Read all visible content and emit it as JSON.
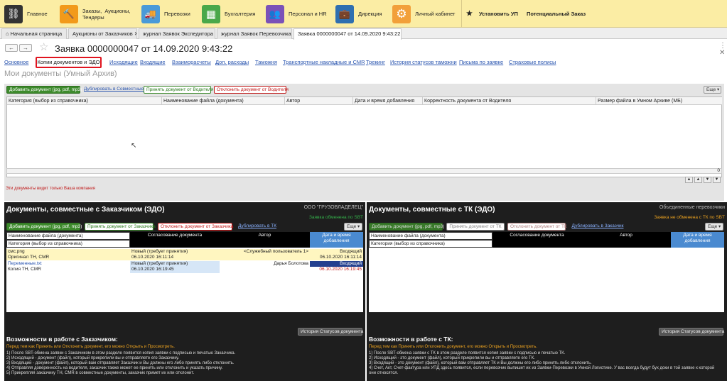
{
  "top_sections": [
    {
      "label": "Главное",
      "color": "#333333",
      "glyph": "⛓"
    },
    {
      "label": "Заказы,  Аукционы,\nТендеры",
      "color": "#f29a1a",
      "glyph": "🔨"
    },
    {
      "label": "Перевозки",
      "color": "#4a9ad8",
      "glyph": "🚚"
    },
    {
      "label": "Бухгалтерия",
      "color": "#4aa84a",
      "glyph": "▦"
    },
    {
      "label": "Персонал и HR",
      "color": "#7a52b8",
      "glyph": "👥"
    },
    {
      "label": "Дирекция",
      "color": "#2f6fb0",
      "glyph": "💼"
    },
    {
      "label": "Личный кабинет",
      "color": "#f2a03a",
      "glyph": "⚙"
    }
  ],
  "top_right": {
    "star": "★",
    "install": "Установить УП",
    "potential": "Потенциальный Заказ"
  },
  "tabs": [
    {
      "label": "⌂  Начальная страница"
    },
    {
      "label": "Аукционы от Заказчиков  ✕"
    },
    {
      "label": "журнал Заявок Экспедитора  ✕"
    },
    {
      "label": "журнал Заявок Перевозчика  ✕"
    },
    {
      "label": "Заявка 0000000047 от 14.09.2020 9:43:22  ✕"
    }
  ],
  "doc": {
    "title": "Заявка 0000000047 от 14.09.2020 9:43:22",
    "back": "←",
    "fwd": "→",
    "star": "☆",
    "win_ctrl": "⋮  ✕"
  },
  "links": [
    "Основное",
    "Копии документов и ЭДО",
    "Исходящие",
    "Входящие",
    "Взаиморасчеты",
    "Доп. расходы",
    "Таможня",
    "Транспортные накладные и CMR",
    "Трекинг",
    "История статусов таможни",
    "Письма по заявке",
    "Страховые полисы"
  ],
  "subtitle": "Мои документы (Умный Архив)",
  "archive": {
    "add_btn": "Добавить документ (jpg, pdf, mp3)",
    "dup_btn": "Дублировать в Совместные",
    "accept_btn": "Принять документ от Водителя",
    "reject_btn": "Отклонить документ от Водителя",
    "more_btn": "Еще ▾",
    "columns": [
      "Категория (выбор из справочника)",
      "Наименование файла (документа)",
      "Автор",
      "Дата и время добавления",
      "Корректность документа от Водителя",
      "Размер файла в Умном Архиве (МБ)"
    ],
    "total": "0",
    "note": "Эти документы видит только Ваша компания"
  },
  "left_panel": {
    "title": "Документы, совместные с Заказчиком (ЭДО)",
    "org": "ООО \"ГРУЗОВЛАДЕЛЕЦ\"",
    "status": "Заявка обменена по SBT",
    "status_color": "#34b04a",
    "add_btn": "Добавить документ (jpg, pdf, mp3)",
    "accept_btn": "Принять документ от Заказчика",
    "reject_btn": "Отклонить документ от Заказчика",
    "dup_btn": "Дублировать в ТК",
    "more_btn": "Еще ▾",
    "col_name": "Наименование файла (документа)",
    "col_cat": "Категория (выбор из справочника)",
    "col_agree": "Согласование документа",
    "col_author": "Автор",
    "col_date": "Дата и время добавления",
    "rows": [
      {
        "name": "смс.png",
        "category": "Оригинал ТН, CMR",
        "agree": "Новый (требует принятия)",
        "agree_date": "06.10.2020 16:11:14",
        "author": "<Служебный пользователь 1>",
        "dir": "Входящий",
        "date": "06.10.2020 16:11:14"
      },
      {
        "name": "Переменные.txt",
        "category": "Копия ТН, CMR",
        "agree": "Новый (требует принятия)",
        "agree_date": "06.10.2020 16:19:45",
        "author": "Дарья Болотова",
        "dir": "Входящий",
        "date": "06.10.2020 16:19:45"
      }
    ],
    "history_btn": "История Статусов документа",
    "caption": "Возможности в работе с Заказчиком:",
    "hint": "Перед тем как Принять или Отклонить документ, его можно Открыть и Просмотреть.",
    "text": [
      "1) После SBT-обмена заявки с Заказчиком в этом разделе появится копия заявки с подписью и печатью Заказчика.",
      "2) Исходящий - документ (файл), который прикрепили вы и отправляете его Заказчику.",
      "3) Входящий - документ (файл), который вам отправляет Заказчик и Вы должны его либо принять либо отклонить.",
      "4) Отправляя доверенность на водителя, заказчик также может ее принять или отклонить и указать причину.",
      "5) Прикрепляя заказчику ТН, CMR в совместные документы, заказчик примет их или отклонит."
    ]
  },
  "right_panel": {
    "title": "Документы, совместные с ТК (ЭДО)",
    "org": "Объединенные перевозчики",
    "status": "Заявка не обменена с ТК по SBT",
    "status_color": "#e8a020",
    "add_btn": "Добавить документ (jpg, pdf, mp3)",
    "accept_btn": "Принять документ от ТК",
    "reject_btn": "Отклонить документ от ТК",
    "dup_btn": "Дублировать в Заказчик",
    "more_btn": "Еще ▾",
    "col_name": "Наименование файла (документа)",
    "col_cat": "Категория (выбор из справочника)",
    "col_agree": "Согласование документа",
    "col_author": "Автор",
    "col_date": "Дата и время добавления",
    "history_btn": "История Статусов документа",
    "caption": "Возможности в работе с ТК:",
    "hint": "Перед тем как Принять или Отклонить документ, его можно Открыть и Просмотреть.",
    "text": [
      "1) После SBT-обмена заявки с ТК в этом разделе появится копия заявки с подписью и печатью ТК.",
      "2) Исходящий - это документ (файл), который прикрепили вы и отправляете его ТК.",
      "3) Входящий - это документ (файл), который вам отправляет ТК и Вы должны его либо принять либо отклонить.",
      "4) Счет, Акт, Счет-фактура или УПД здесь появится, если перевозчик выпишет их из Заявки-Перевозки в Умной Логистике. У вас всегда будут бух доки в той заявке к которой",
      "они относятся."
    ]
  }
}
